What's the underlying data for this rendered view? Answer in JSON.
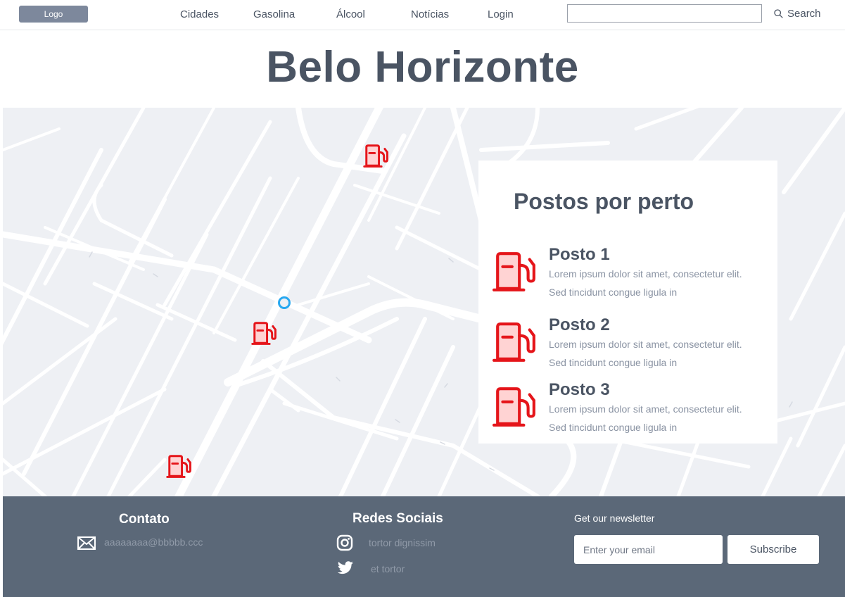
{
  "nav": {
    "logo": "Logo",
    "links": [
      "Cidades",
      "Gasolina",
      "Álcool",
      "Notícias",
      "Login"
    ],
    "search_placeholder": "",
    "search_label": "Search"
  },
  "page_title": "Belo Horizonte",
  "map": {
    "marker_icon": "fuel-pump-icon",
    "marker_color": "#e5151a",
    "location_color": "#28a8f0"
  },
  "panel": {
    "title": "Postos por perto",
    "items": [
      {
        "name": "Posto 1",
        "desc": "Lorem ipsum dolor sit amet, consectetur elit. Sed tincidunt congue ligula in"
      },
      {
        "name": "Posto 2",
        "desc": "Lorem ipsum dolor sit amet, consectetur elit. Sed tincidunt congue ligula in"
      },
      {
        "name": "Posto 3",
        "desc": "Lorem ipsum dolor sit amet, consectetur elit. Sed tincidunt congue ligula in"
      }
    ]
  },
  "footer": {
    "contact_heading": "Contato",
    "contact_email": "aaaaaaaa@bbbbb.ccc",
    "social_heading": "Redes Sociais",
    "instagram_text": "tortor dignissim",
    "twitter_text": "et tortor",
    "newsletter_label": "Get our newsletter",
    "email_placeholder": "Enter your email",
    "subscribe_label": "Subscribe"
  },
  "colors": {
    "footer_bg": "#5b6878",
    "map_bg": "#eef0f4",
    "text": "#4a5463",
    "accent_red": "#e5151a"
  }
}
